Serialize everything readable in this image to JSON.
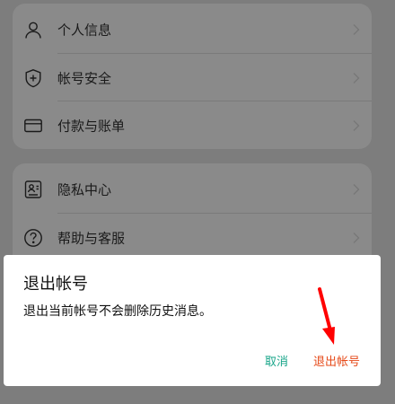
{
  "settings": {
    "group1": [
      {
        "label": "个人信息",
        "icon": "person-icon"
      },
      {
        "label": "帐号安全",
        "icon": "shield-plus-icon"
      },
      {
        "label": "付款与账单",
        "icon": "credit-card-icon"
      }
    ],
    "group2": [
      {
        "label": "隐私中心",
        "icon": "id-card-icon"
      },
      {
        "label": "帮助与客服",
        "icon": "question-circle-icon"
      }
    ]
  },
  "dialog": {
    "title": "退出帐号",
    "message": "退出当前帐号不会删除历史消息。",
    "cancel_label": "取消",
    "confirm_label": "退出帐号"
  },
  "colors": {
    "overlay_background": "#7d7d7d",
    "card_background": "#8a8a8a",
    "cancel_text": "#17a589",
    "confirm_text": "#e64a19",
    "annotation_arrow": "#ff0000"
  }
}
